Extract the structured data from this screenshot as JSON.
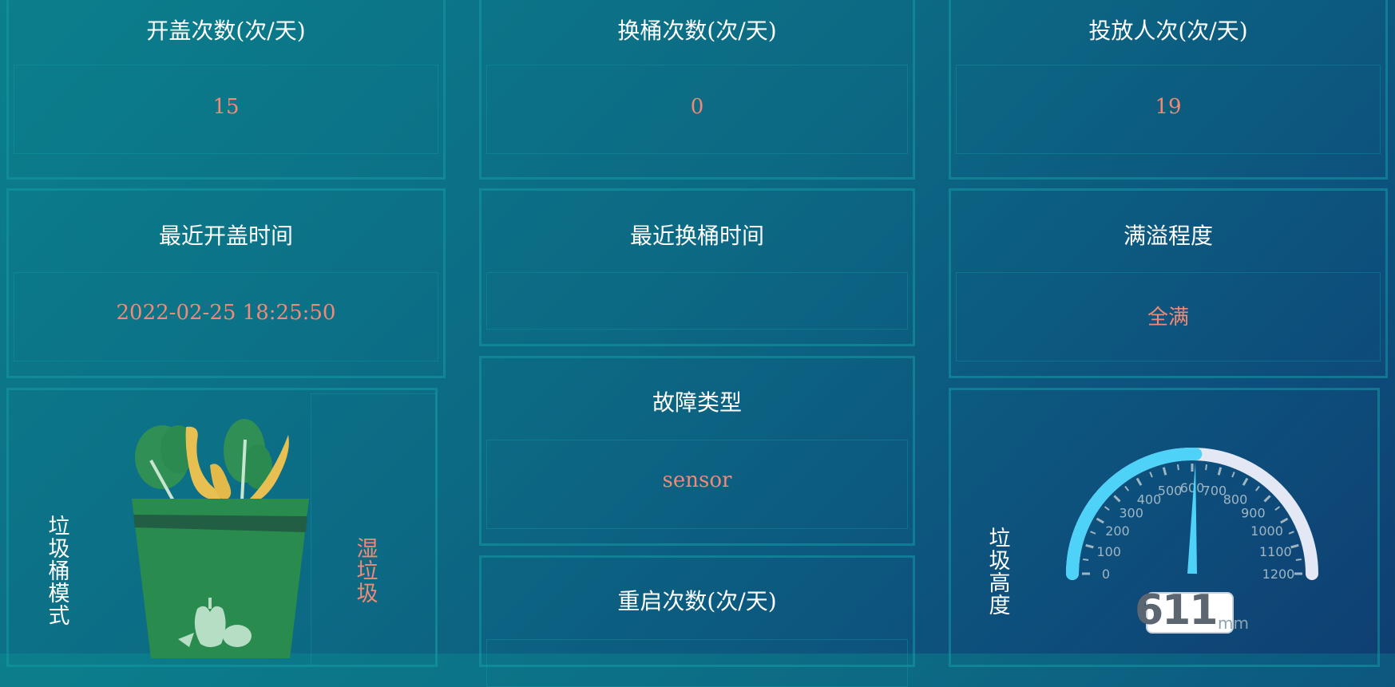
{
  "cards": {
    "open_count": {
      "title": "开盖次数(次/天)",
      "value": "15"
    },
    "change_count": {
      "title": "换桶次数(次/天)",
      "value": "0"
    },
    "drop_count": {
      "title": "投放人次(次/天)",
      "value": "19"
    },
    "last_open": {
      "title": "最近开盖时间",
      "value": "2022-02-25 18:25:50"
    },
    "last_change": {
      "title": "最近换桶时间",
      "value": ""
    },
    "overflow": {
      "title": "满溢程度",
      "value": "全满"
    },
    "fault": {
      "title": "故障类型",
      "value": "sensor"
    },
    "restart": {
      "title": "重启次数(次/天)"
    }
  },
  "bin_mode": {
    "label": "垃圾桶模式",
    "value": "湿垃圾",
    "icon": "wet-garbage-bin-icon"
  },
  "height_gauge": {
    "label": "垃圾高度",
    "value": 611,
    "unit": "mm",
    "min": 0,
    "max": 1200,
    "ticks": [
      "0",
      "100",
      "200",
      "300",
      "400",
      "500",
      "600",
      "700",
      "800",
      "900",
      "1000",
      "1100",
      "1200"
    ],
    "colors": {
      "fill": "#4fd2f7",
      "track": "#e3e8f4",
      "tick_text": "#9fb6c2"
    }
  }
}
